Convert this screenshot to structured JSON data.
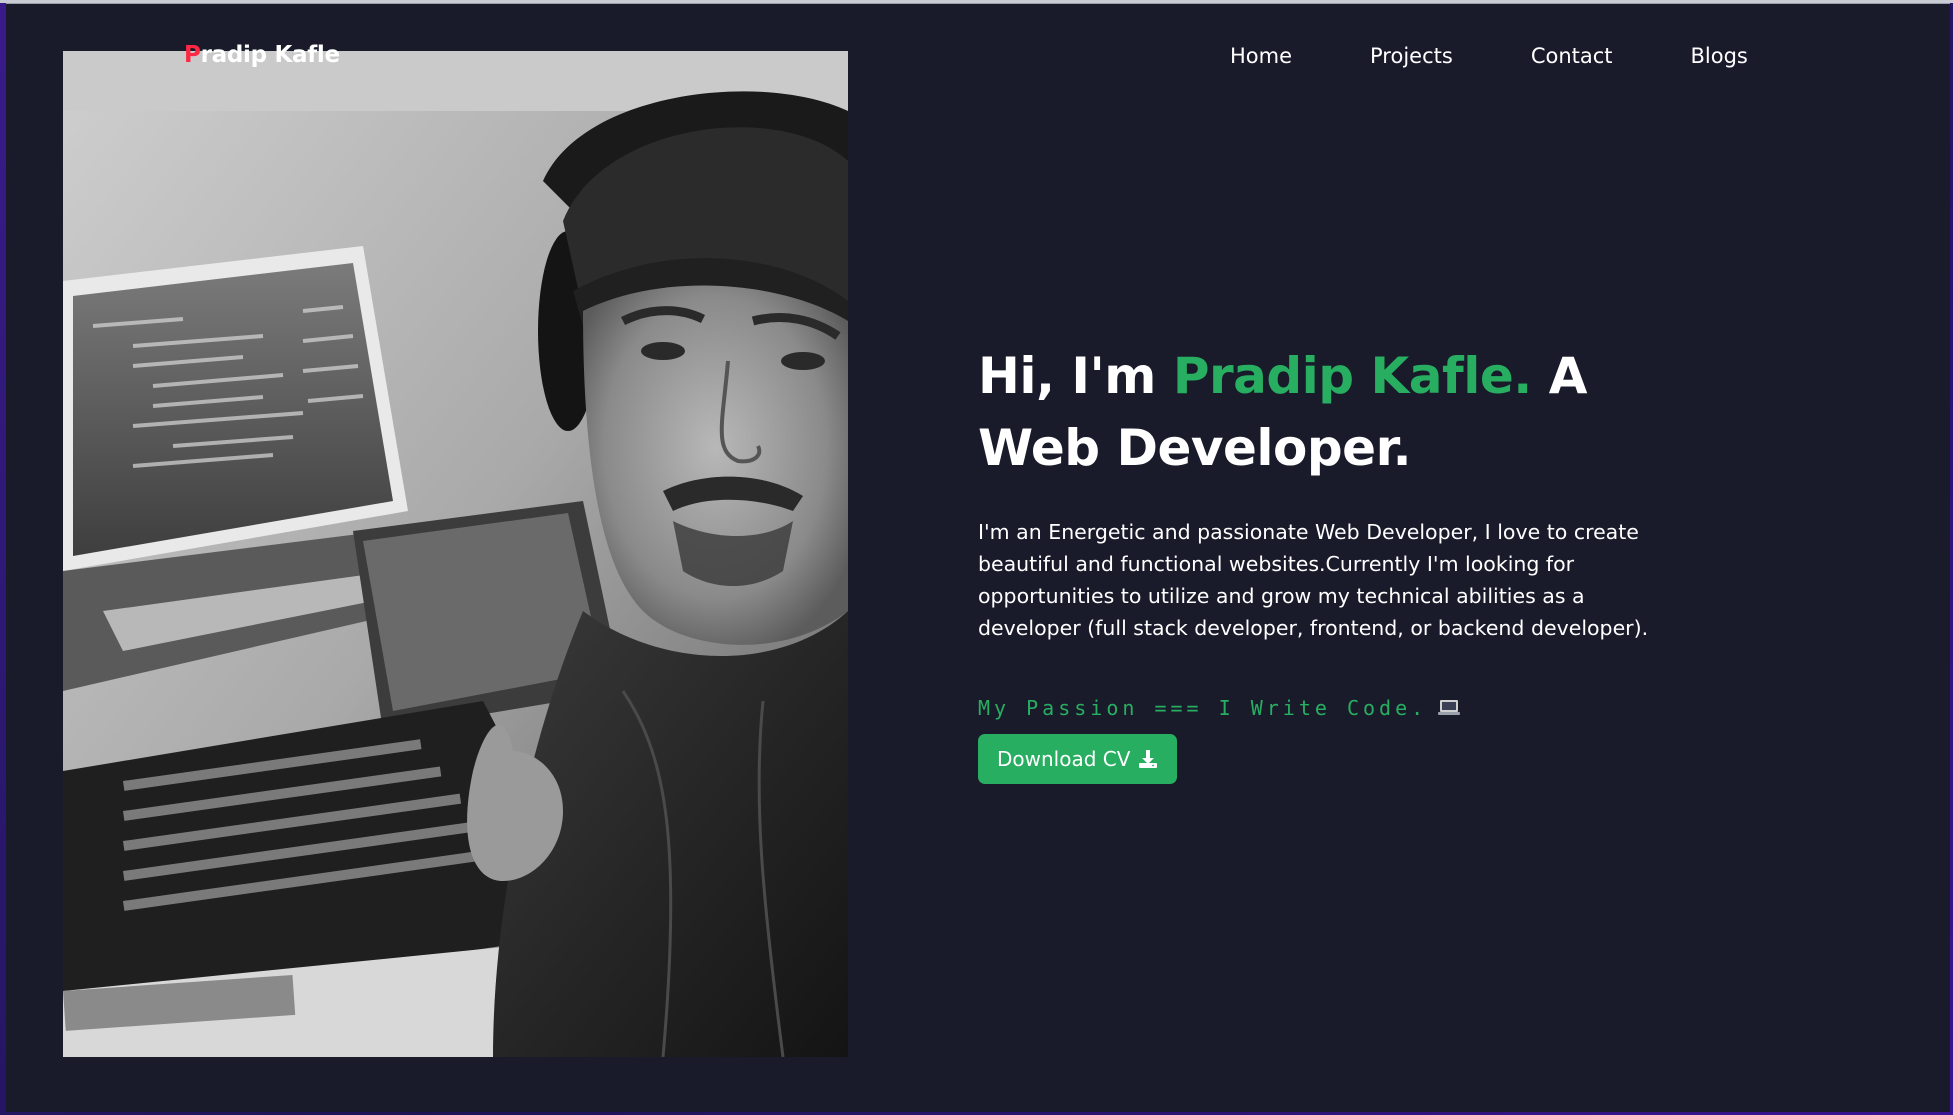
{
  "logo": {
    "first_letter": "P",
    "rest": "radip Kafle"
  },
  "nav": {
    "items": [
      {
        "label": "Home"
      },
      {
        "label": "Projects"
      },
      {
        "label": "Contact"
      },
      {
        "label": "Blogs"
      }
    ]
  },
  "hero": {
    "title_prefix": "Hi, I'm ",
    "title_name": "Pradip Kafle.",
    "title_suffix": " A Web Developer.",
    "description": "I'm an Energetic and passionate Web Developer, I love to create beautiful and functional websites.Currently I'm looking for opportunities to utilize and grow my technical abilities as a developer (full stack developer, frontend, or backend developer).",
    "passion": "My Passion === I Write Code.",
    "passion_icon": "laptop-icon",
    "cv_button_label": "Download CV",
    "cv_button_icon": "download-icon"
  },
  "colors": {
    "background": "#191b2b",
    "accent": "#27ae60",
    "logo_first_letter": "#ff2742",
    "text": "#ffffff"
  }
}
